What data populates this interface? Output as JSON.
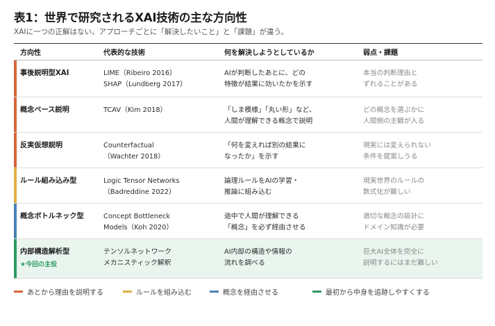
{
  "title": "表1：世界で研究されるXAI技術の主な方向性",
  "subtitle": "XAIに一つの正解はない。アプローチごとに「解決したいこと」と「課題」が違う。",
  "headers": [
    "方向性",
    "代表的な技術",
    "何を解決しようとしているか",
    "弱点・課題"
  ],
  "rows": [
    {
      "direction": "事後説明型XAI",
      "tech": [
        "LIME（Ribeiro 2016）",
        "SHAP（Lundberg 2017）"
      ],
      "goal": [
        "AIが判断したあとに、どの",
        "特徴が結果に効いたかを示す"
      ],
      "weakness": [
        "本当の判断理由と",
        "ずれることがある"
      ],
      "color": "#d9643a"
    },
    {
      "direction": "概念ベース説明",
      "tech": [
        "TCAV（Kim 2018）"
      ],
      "goal": [
        "「しま模様」「丸い形」など、",
        "人間が理解できる概念で説明"
      ],
      "weakness": [
        "どの概念を選ぶかに",
        "人間側の主観が入る"
      ],
      "color": "#d9643a"
    },
    {
      "direction": "反実仮想説明",
      "tech": [
        "Counterfactual",
        "（Wachter 2018）"
      ],
      "goal": [
        "「何を変えれば別の結果に",
        "なったか」を示す"
      ],
      "weakness": [
        "現実には変えられない",
        "条件を提案しうる"
      ],
      "color": "#d9643a"
    },
    {
      "direction": "ルール組み込み型",
      "tech": [
        "Logic Tensor Networks",
        "（Badreddine 2022）"
      ],
      "goal": [
        "論理ルールをAIの学習・",
        "推論に組み込む"
      ],
      "weakness": [
        "現実世界のルールの",
        "数式化が難しい"
      ],
      "color": "#e0b040"
    },
    {
      "direction": "概念ボトルネック型",
      "tech": [
        "Concept Bottleneck",
        "Models（Koh 2020）"
      ],
      "goal": [
        "途中で人間が理解できる",
        "「概念」を必ず経由させる"
      ],
      "weakness": [
        "適切な概念の設計に",
        "ドメイン知識が必要"
      ],
      "color": "#4a7fb5"
    },
    {
      "direction": "内部構造解析型",
      "sublabel": "★今回の主役",
      "tech": [
        "テンソルネットワーク",
        "メカニスティック解釈"
      ],
      "goal": [
        "AI内部の構造や情報の",
        "流れを調べる"
      ],
      "weakness": [
        "巨大AI全体を完全に",
        "説明するにはまだ難しい"
      ],
      "color": "#2e9a63"
    }
  ],
  "legend": [
    {
      "label": "あとから理由を説明する",
      "color": "#d9643a"
    },
    {
      "label": "ルールを組み込む",
      "color": "#e0b040"
    },
    {
      "label": "概念を経由させる",
      "color": "#4a7fb5"
    },
    {
      "label": "最初から中身を追跡しやすくする",
      "color": "#2e9a63"
    }
  ]
}
